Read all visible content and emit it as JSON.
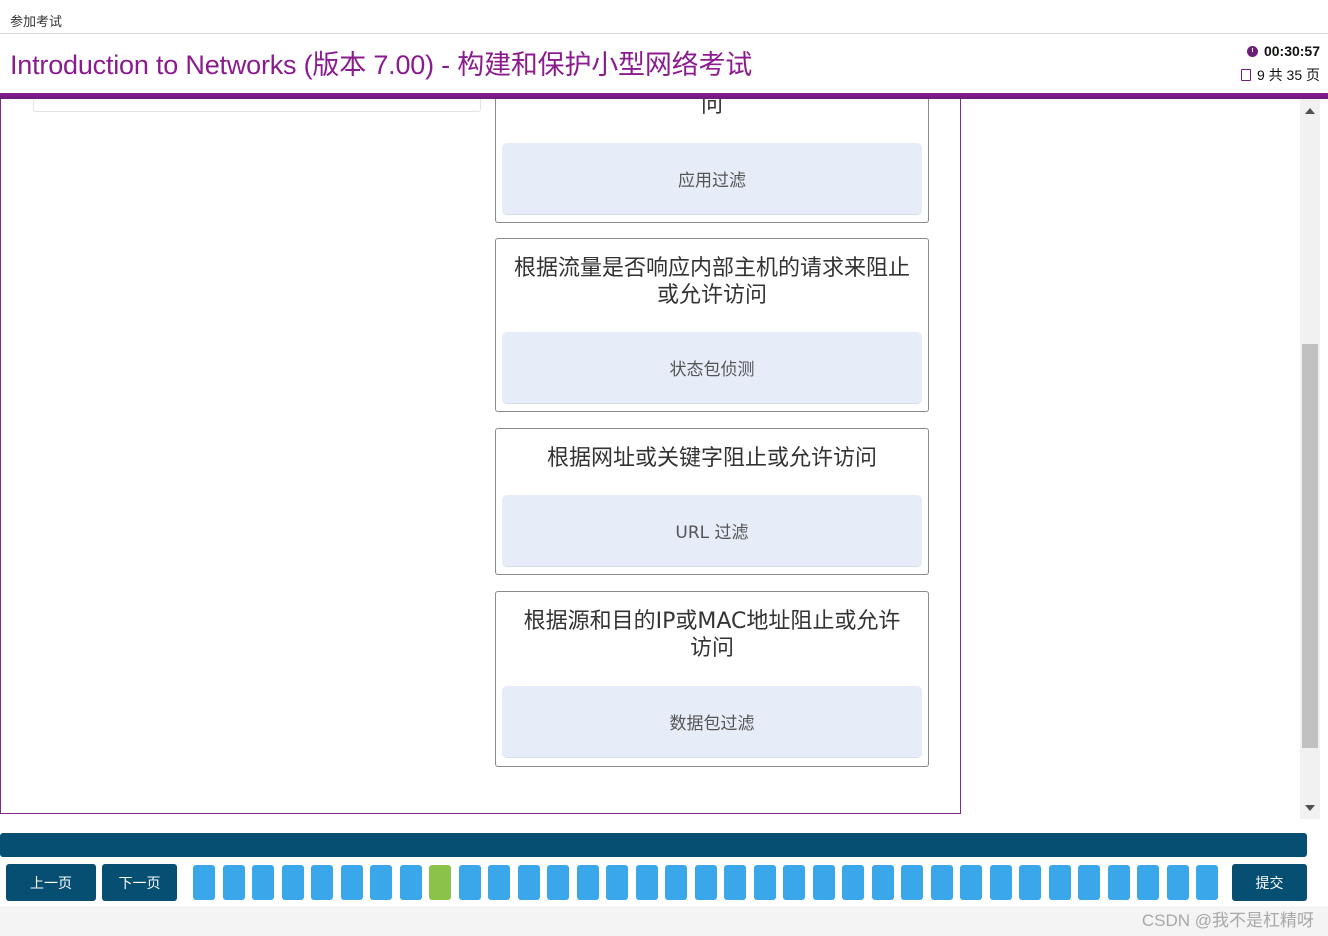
{
  "topbar": {
    "label": "参加考试"
  },
  "header": {
    "title": "Introduction to Networks (版本 7.00) - 构建和保护小型网络考试",
    "timer": "00:30:57",
    "page_indicator": "9 共 35 页"
  },
  "cards": [
    {
      "question": "问",
      "answer": "应用过滤"
    },
    {
      "question": "根据流量是否响应内部主机的请求来阻止或允许访问",
      "answer": "状态包侦测"
    },
    {
      "question": "根据网址或关键字阻止或允许访问",
      "answer": "URL 过滤"
    },
    {
      "question": "根据源和目的IP或MAC地址阻止或允许访问",
      "answer": "数据包过滤"
    }
  ],
  "footer": {
    "prev_label": "上一页",
    "next_label": "下一页",
    "submit_label": "提交",
    "question_count": 35,
    "current_index": 9
  },
  "watermark": "CSDN @我不是杠精呀",
  "colors": {
    "brand_purple": "#8b1c8f",
    "nav_blue": "#064f72",
    "dot_blue": "#3aa7ea",
    "dot_current": "#8bc24a",
    "answer_bg": "#e6ecf8"
  }
}
